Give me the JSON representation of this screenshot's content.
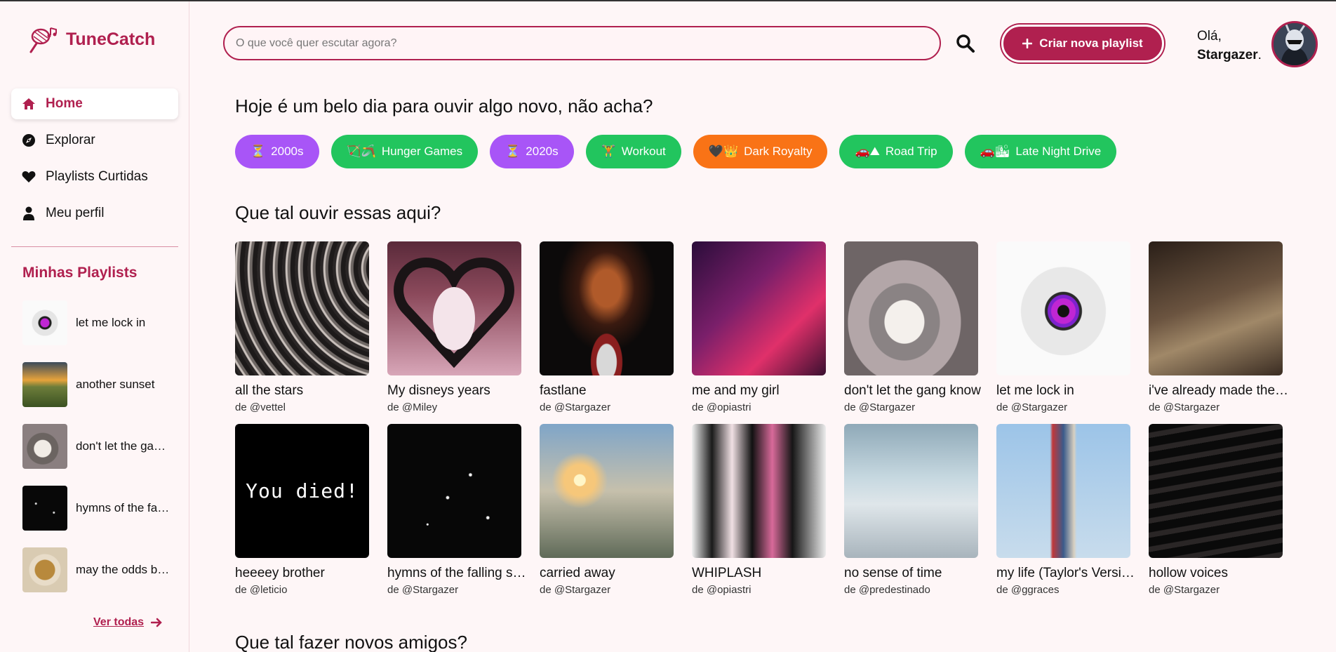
{
  "app": {
    "name": "TuneCatch"
  },
  "nav": [
    {
      "label": "Home",
      "icon": "home-icon",
      "active": true
    },
    {
      "label": "Explorar",
      "icon": "compass-icon",
      "active": false
    },
    {
      "label": "Playlists Curtidas",
      "icon": "heart-icon",
      "active": false
    },
    {
      "label": "Meu perfil",
      "icon": "user-icon",
      "active": false
    }
  ],
  "my_playlists": {
    "title": "Minhas Playlists",
    "items": [
      {
        "label": "let me lock in"
      },
      {
        "label": "another sunset"
      },
      {
        "label": "don't let the gang know"
      },
      {
        "label": "hymns of the falling stars"
      },
      {
        "label": "may the odds be ever"
      }
    ],
    "see_all": "Ver todas"
  },
  "header": {
    "search_placeholder": "O que você quer escutar agora?",
    "create_label": "Criar nova playlist",
    "greeting_prefix": "Olá,",
    "username": "Stargazer",
    "greeting_suffix": "."
  },
  "main": {
    "intro": "Hoje é um belo dia para ouvir algo novo, não acha?",
    "chips": [
      {
        "emoji": "⏳",
        "label": "2000s",
        "color": "#a855f7"
      },
      {
        "emoji": "🏹🪃",
        "label": "Hunger Games",
        "color": "#22c55e"
      },
      {
        "emoji": "⏳",
        "label": "2020s",
        "color": "#a855f7"
      },
      {
        "emoji": "🏋",
        "label": "Workout",
        "color": "#22c55e"
      },
      {
        "emoji": "🖤👑",
        "label": "Dark Royalty",
        "color": "#f97316"
      },
      {
        "emoji": "🚗⛰",
        "label": "Road Trip",
        "color": "#22c55e"
      },
      {
        "emoji": "🚗🏙",
        "label": "Late Night Drive",
        "color": "#22c55e"
      }
    ],
    "suggest_title": "Que tal ouvir essas aqui?",
    "playlists_row1": [
      {
        "title": "all the stars",
        "by": "de @vettel"
      },
      {
        "title": "My disneys years",
        "by": "de @Miley"
      },
      {
        "title": "fastlane",
        "by": "de @Stargazer"
      },
      {
        "title": "me and my girl",
        "by": "de @opiastri"
      },
      {
        "title": "don't let the gang know",
        "by": "de @Stargazer"
      },
      {
        "title": "let me lock in",
        "by": "de @Stargazer"
      },
      {
        "title": "i've already made the choice",
        "by": "de @Stargazer"
      }
    ],
    "playlists_row2": [
      {
        "title": "heeeey brother",
        "by": "de @leticio",
        "overlay": "You died!"
      },
      {
        "title": "hymns of the falling stars",
        "by": "de @Stargazer"
      },
      {
        "title": "carried away",
        "by": "de @Stargazer"
      },
      {
        "title": "WHIPLASH",
        "by": "de @opiastri"
      },
      {
        "title": "no sense of time",
        "by": "de @predestinado"
      },
      {
        "title": "my life (Taylor's Version)",
        "by": "de @ggraces"
      },
      {
        "title": "hollow voices",
        "by": "de @Stargazer"
      }
    ],
    "friends_title": "Que tal fazer novos amigos?"
  },
  "colors": {
    "brand": "#b0204f",
    "background": "#fef6f7"
  }
}
